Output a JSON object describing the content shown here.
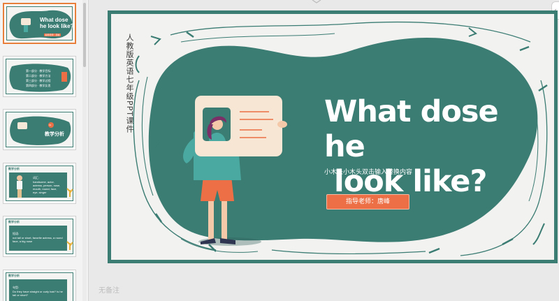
{
  "thumbnails": [
    {
      "title": "What dose he look like?",
      "button": "指导老师：唐峰"
    },
    {
      "items": [
        "第一部分 · 教学目标",
        "第二部分 · 教学方法",
        "第三部分 · 教学过程",
        "第四部分 · 教学反思"
      ]
    },
    {
      "badge": "01",
      "title": "教学分析"
    },
    {
      "header": "教学分析",
      "label": "词汇:",
      "body": "handsome, actor, actress, person, nose, mouth, round, face, eye, singer"
    },
    {
      "header": "教学分析",
      "label": "短语:",
      "body": "not tall or short, favorite actress, a round face, a big nose"
    },
    {
      "header": "教学分析",
      "label": "句型:",
      "body": "Do they have straight or curly hair? Is he tall or short?"
    }
  ],
  "slide": {
    "vertical_subtitle": "人教版英语七年级PPT课件",
    "title_line1": "What dose he",
    "title_line2": " look like?",
    "subtitle": "小木头小木头双击输入替换内容",
    "teacher_button": "指导老师：唐峰"
  },
  "notes_placeholder": "无备注",
  "colors": {
    "teal": "#3b7c73",
    "orange": "#ec6f45",
    "canvas": "#f2f2f0"
  }
}
